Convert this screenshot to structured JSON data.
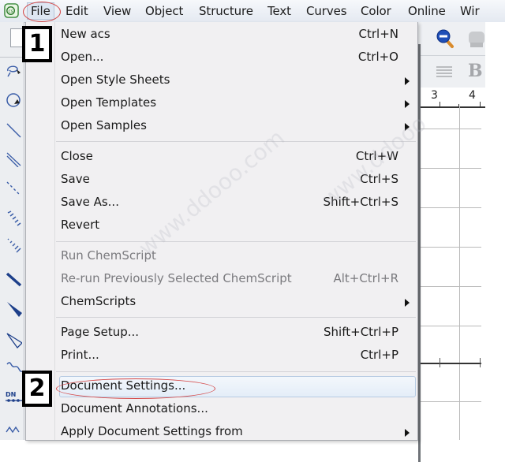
{
  "menubar": {
    "items": [
      {
        "label": "File",
        "active": true
      },
      {
        "label": "Edit"
      },
      {
        "label": "View"
      },
      {
        "label": "Object"
      },
      {
        "label": "Structure"
      },
      {
        "label": "Text"
      },
      {
        "label": "Curves"
      },
      {
        "label": "Color"
      },
      {
        "label": "Online"
      },
      {
        "label": "Wir"
      }
    ]
  },
  "file_menu": {
    "groups": [
      [
        {
          "label": "New acs",
          "shortcut": "Ctrl+N"
        },
        {
          "label": "Open...",
          "shortcut": "Ctrl+O"
        },
        {
          "label": "Open Style Sheets",
          "submenu": true
        },
        {
          "label": "Open Templates",
          "submenu": true
        },
        {
          "label": "Open Samples",
          "submenu": true
        }
      ],
      [
        {
          "label": "Close",
          "shortcut": "Ctrl+W"
        },
        {
          "label": "Save",
          "shortcut": "Ctrl+S"
        },
        {
          "label": "Save As...",
          "shortcut": "Shift+Ctrl+S"
        },
        {
          "label": "Revert"
        }
      ],
      [
        {
          "label": "Run ChemScript",
          "disabled": true
        },
        {
          "label": "Re-run Previously Selected ChemScript",
          "shortcut": "Alt+Ctrl+R",
          "disabled": true
        },
        {
          "label": "ChemScripts",
          "submenu": true
        }
      ],
      [
        {
          "label": "Page Setup...",
          "shortcut": "Shift+Ctrl+P"
        },
        {
          "label": "Print...",
          "shortcut": "Ctrl+P"
        }
      ],
      [
        {
          "label": "Document Settings...",
          "highlighted": true
        },
        {
          "label": "Document Annotations..."
        },
        {
          "label": "Apply Document Settings from",
          "submenu": true
        }
      ]
    ]
  },
  "annotations": {
    "step1": "1",
    "step2": "2"
  },
  "ruler": {
    "ticks": [
      "3",
      "4"
    ]
  },
  "left_toolbar": {
    "tools": [
      "lasso-tool",
      "rotate-tool",
      "solid-bond",
      "double-bond",
      "dashed-bond",
      "hashed-bond",
      "hashed-wedge-bond",
      "bold-bond",
      "wedge-bond",
      "hollow-wedge-bond",
      "wavy-bond",
      "dna-tool",
      "chain-tool"
    ]
  },
  "right_toolbar": {
    "icons": [
      "zoom-out-icon",
      "template-icon",
      "align-icon",
      "bold-icon"
    ],
    "bold_label": "B"
  },
  "colors": {
    "annotation_red": "#d44848",
    "highlight": "#b7cbe3",
    "menu_bg": "#f1f0f2"
  }
}
